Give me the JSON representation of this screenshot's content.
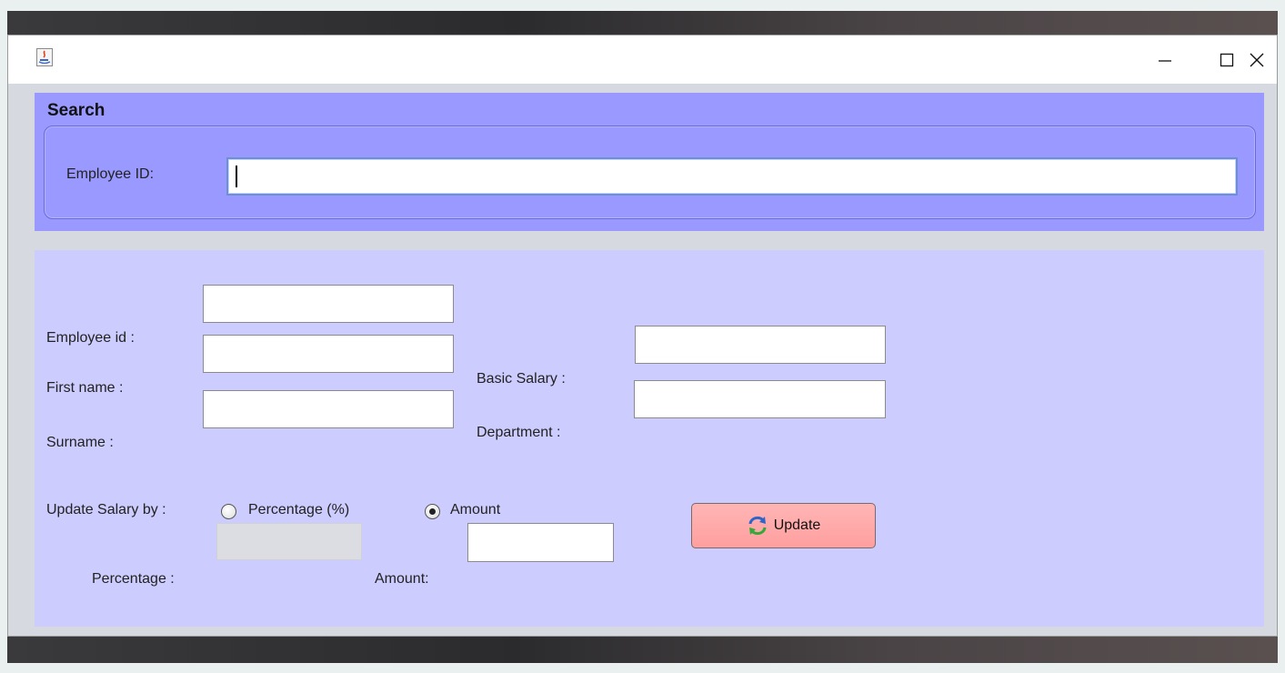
{
  "window": {
    "minimize_symbol": "—",
    "maximize_symbol": "☐",
    "close_symbol": "✕",
    "app_icon": "java-icon"
  },
  "search": {
    "title": "Search",
    "employee_id_label": "Employee ID:",
    "employee_id_value": ""
  },
  "form": {
    "employee_id_label": "Employee id :",
    "employee_id_value": "",
    "first_name_label": "First name :",
    "first_name_value": "",
    "surname_label": "Surname :",
    "surname_value": "",
    "basic_salary_label": "Basic Salary :",
    "basic_salary_value": "",
    "department_label": "Department :",
    "department_value": "",
    "update_salary_by_label": "Update Salary by :",
    "option_percentage_label": "Percentage (%)",
    "option_amount_label": "Amount",
    "selected_option": "Amount",
    "percentage_label": "Percentage :",
    "percentage_value": "",
    "amount_label": "Amount:",
    "amount_value": "",
    "update_button_label": "Update",
    "update_button_icon": "refresh-icon"
  },
  "colors": {
    "search_panel": "#9999ff",
    "form_panel": "#ccccff",
    "update_button": "#ffa8a8"
  }
}
